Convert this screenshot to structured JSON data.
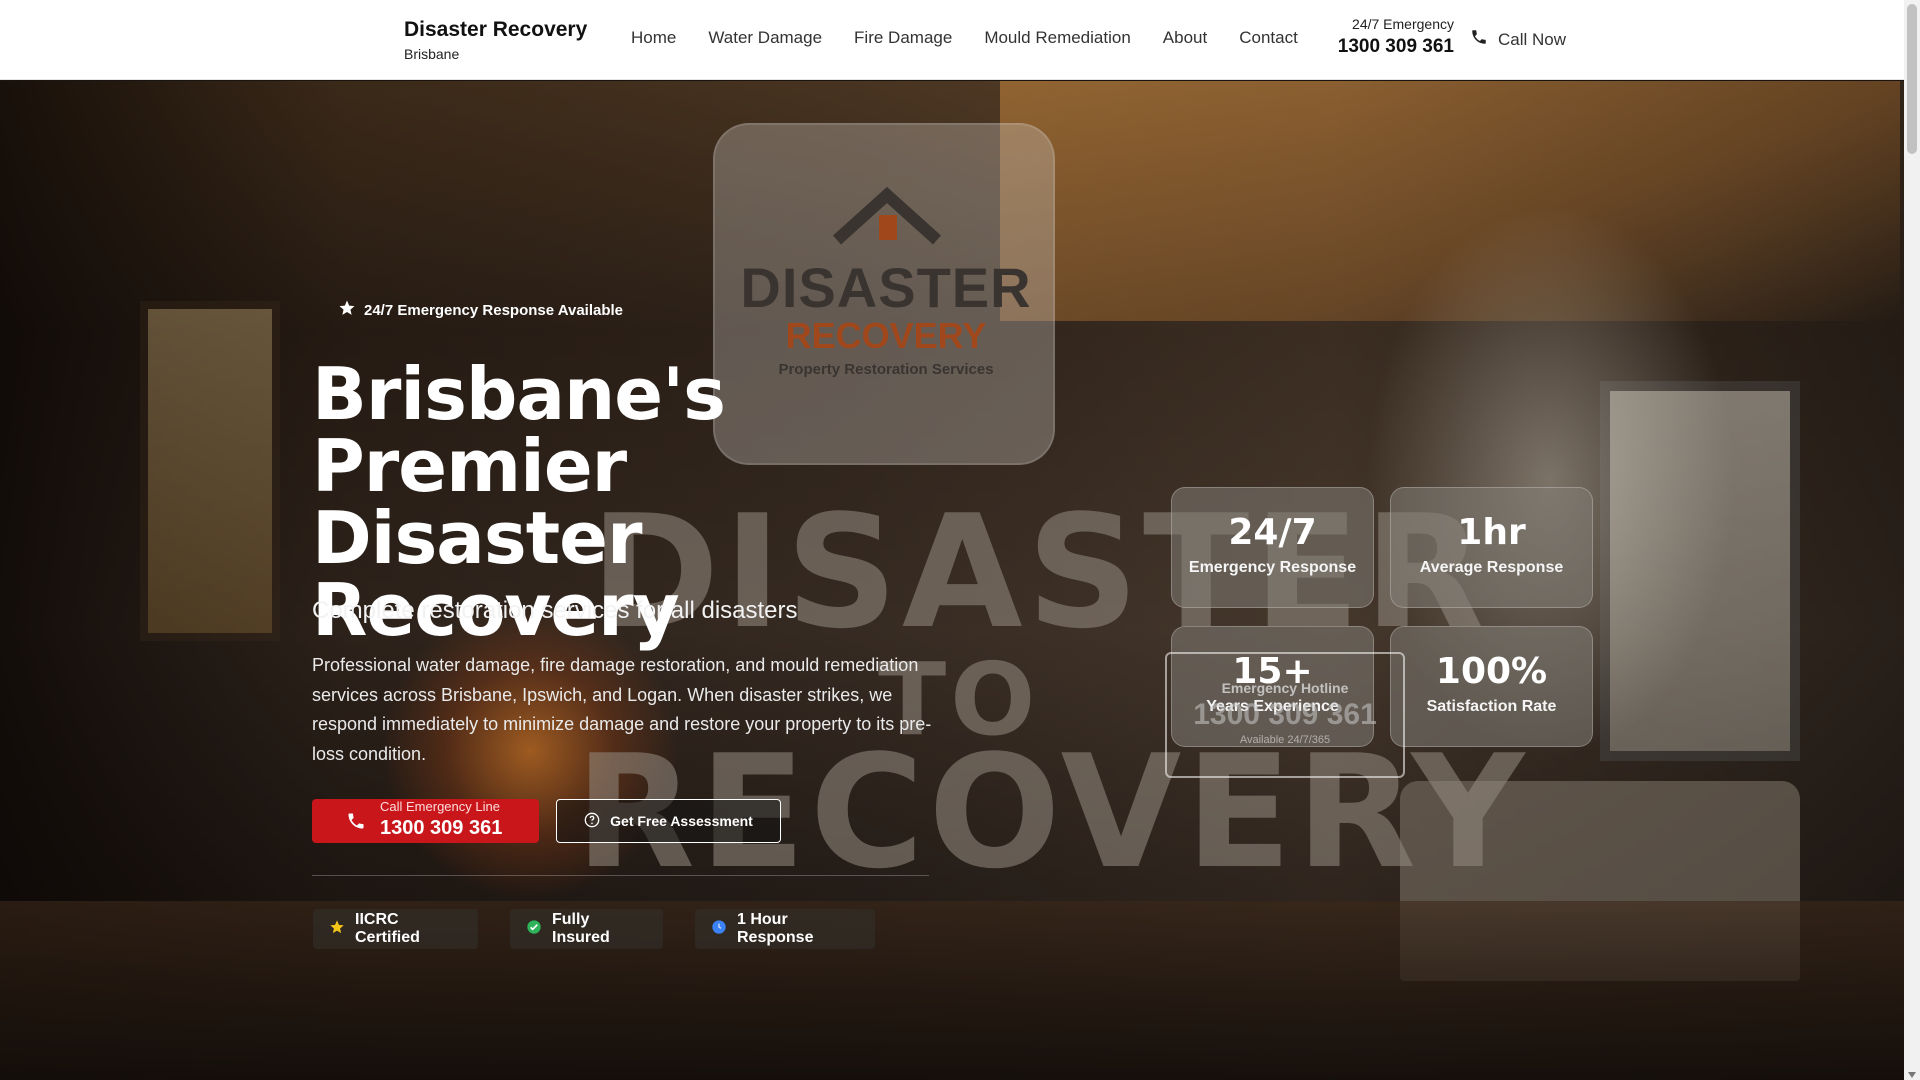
{
  "header": {
    "brand_name": "Disaster Recovery",
    "brand_sub": "Brisbane",
    "nav": [
      "Home",
      "Water Damage",
      "Fire Damage",
      "Mould Remediation",
      "About",
      "Contact"
    ],
    "emergency_label": "24/7 Emergency",
    "emergency_number": "1300 309 361",
    "call_now_label": "Call Now"
  },
  "hero": {
    "logo": {
      "title": "DISASTER",
      "subtitle": "RECOVERY",
      "tagline": "Property Restoration Services"
    },
    "watermark": [
      "DISASTER",
      "TO",
      "RECOVERY"
    ],
    "badge": "24/7 Emergency Response Available",
    "headline": "Brisbane's Premier Disaster Recovery",
    "subheadline": "Complete restoration services for all disasters",
    "paragraph": "Professional water damage, fire damage restoration, and mould remediation services across Brisbane, Ipswich, and Logan. When disaster strikes, we respond immediately to minimize damage and restore your property to its pre-loss condition.",
    "call_button": {
      "small": "Call Emergency Line",
      "number": "1300 309 361"
    },
    "assessment_button": "Get Free Assessment",
    "trust_badges": [
      "IICRC Certified",
      "Fully Insured",
      "1 Hour Response"
    ],
    "stats": [
      {
        "value": "24/7",
        "label": "Emergency Response"
      },
      {
        "value": "1hr",
        "label": "Average Response"
      },
      {
        "value": "15+",
        "label": "Years Experience"
      },
      {
        "value": "100%",
        "label": "Satisfaction Rate"
      }
    ],
    "hotline": {
      "label": "Emergency Hotline",
      "number": "1300 309 361",
      "availability": "Available 24/7/365"
    }
  },
  "colors": {
    "accent_red": "#c8161b",
    "check_green": "#2fb35a",
    "info_blue": "#3b82f6",
    "star_gold": "#f5c518"
  }
}
